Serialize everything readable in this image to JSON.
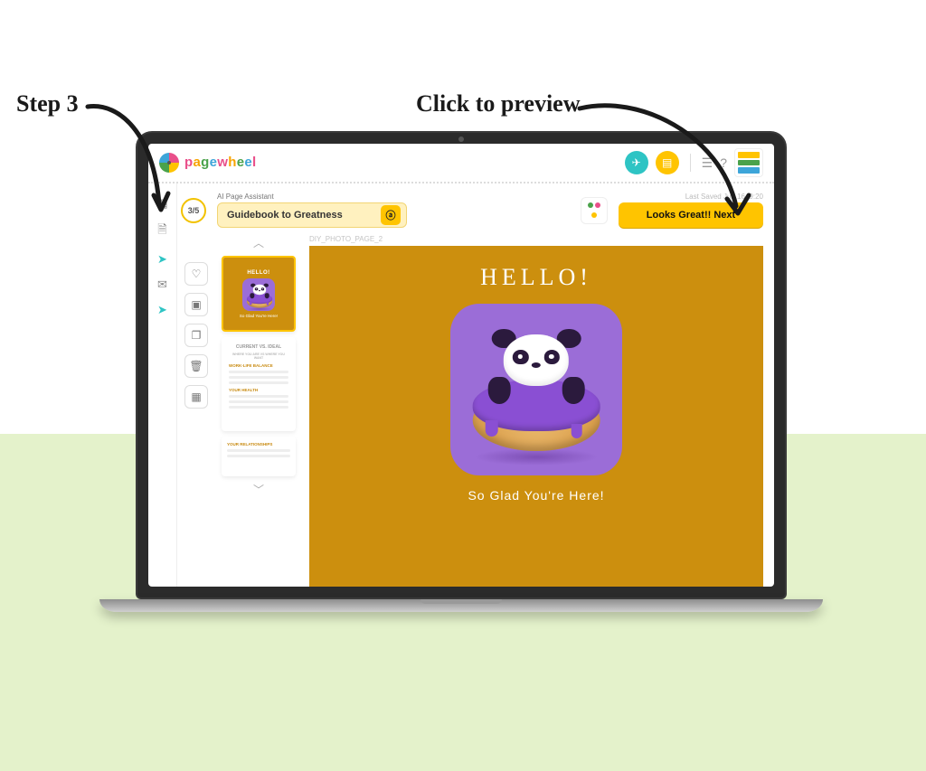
{
  "annotations": {
    "left": "Step 3",
    "right": "Click to preview"
  },
  "brand": {
    "name_chars": [
      "p",
      "a",
      "g",
      "e",
      "w",
      "h",
      "e",
      "e",
      "l"
    ]
  },
  "header": {
    "icons": [
      "paper-plane",
      "document",
      "list",
      "help"
    ]
  },
  "left_rail": {
    "icons": [
      "grid",
      "file",
      "rocket",
      "mail",
      "rocket"
    ]
  },
  "toolbar": {
    "step_badge": "3/5",
    "assistant_label": "AI Page Assistant",
    "assistant_value": "Guidebook to Greatness",
    "last_saved": "Last Saved Jun 16, 9:20",
    "next_label": "Looks Great!! Next"
  },
  "tools": {
    "items": [
      "heart",
      "image",
      "page",
      "trash",
      "grid"
    ]
  },
  "thumbnails": {
    "t1": {
      "title": "HELLO!",
      "subtitle": "So Glad You're Here!"
    },
    "t2": {
      "header": "CURRENT VS. IDEAL",
      "sub": "WHERE YOU ARE VS WHERE YOU WANT",
      "sections": [
        "WORK-LIFE BALANCE",
        "YOUR HEALTH"
      ]
    },
    "t3": {
      "section": "YOUR RELATIONSHIPS"
    }
  },
  "canvas": {
    "label": "DIY_PHOTO_PAGE_2",
    "title": "HELLO!",
    "subtitle": "So Glad You're Here!"
  }
}
